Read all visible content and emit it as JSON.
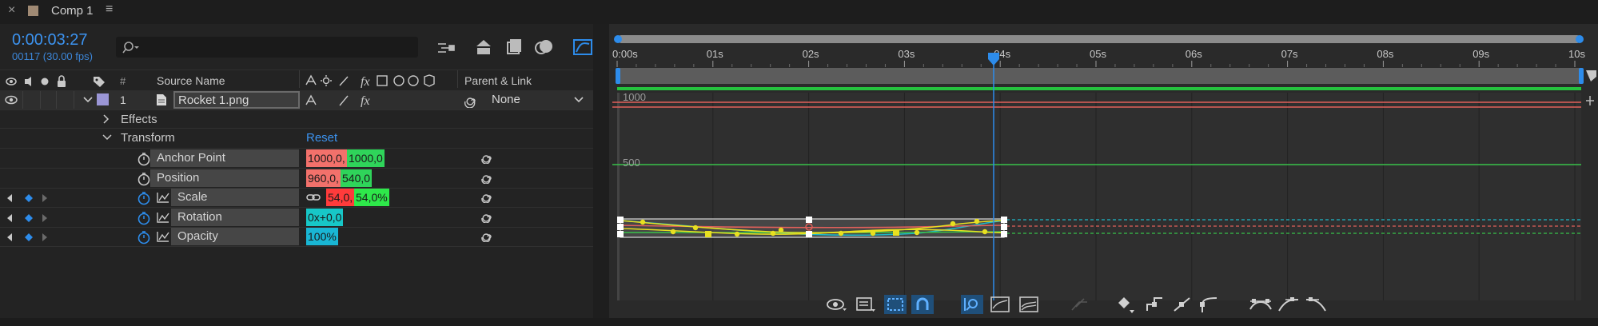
{
  "tab": {
    "close_glyph": "×",
    "title": "Comp 1",
    "menu_glyph": "≡",
    "swatch_color": "#a08a74"
  },
  "timecode": {
    "time": "0:00:03:27",
    "frames": "00117 (30.00 fps)",
    "search_placeholder": ""
  },
  "columns": {
    "number": "#",
    "source_name": "Source Name",
    "parent_link": "Parent & Link",
    "fx": "fx"
  },
  "layer": {
    "number": "1",
    "name": "Rocket 1.png",
    "parent": "None",
    "color": "#9b96d6"
  },
  "groups": {
    "effects": "Effects",
    "transform": "Transform",
    "reset": "Reset"
  },
  "properties": [
    {
      "name": "Anchor Point",
      "v1": "1000,0,",
      "v2": "1000,0",
      "c1": "#f2716b",
      "c2": "#2fd45a",
      "animated": false
    },
    {
      "name": "Position",
      "v1": "960,0,",
      "v2": "540,0",
      "c1": "#f2716b",
      "c2": "#2fd45a",
      "animated": false
    },
    {
      "name": "Scale",
      "v1": "54,0,",
      "v2": "54,0%",
      "c1": "#ff3b3b",
      "c2": "#2ee84a",
      "animated": true
    },
    {
      "name": "Rotation",
      "v1": "0x+0,0",
      "v2": "",
      "c1": "#17c7c7",
      "c2": "",
      "animated": true
    },
    {
      "name": "Opacity",
      "v1": "100%",
      "v2": "",
      "c1": "#19b6d4",
      "c2": "",
      "animated": true
    }
  ],
  "ruler": {
    "labels": [
      "0:00s",
      "01s",
      "02s",
      "03s",
      "04s",
      "05s",
      "06s",
      "07s",
      "08s",
      "09s",
      "10s"
    ]
  },
  "graph": {
    "label_top": "1000",
    "label_mid": "500",
    "colors": {
      "red": "#e2605a",
      "green": "#38c24a",
      "cyan": "#1fb8c8",
      "yellow": "#e8e020",
      "playhead": "#2d8ceb"
    }
  },
  "icons": {
    "graph_toolbar": [
      "eye-icon",
      "properties-list-icon",
      "transform-box-icon",
      "snap-magnet-icon",
      "auto-zoom-height-icon",
      "fit-selection-icon",
      "fit-all-icon",
      "separate-dimensions-icon",
      "edit-keyframe-icon",
      "hold-keyframe-icon",
      "linear-keyframe-icon",
      "auto-bezier-icon",
      "easy-ease-icon",
      "easy-ease-in-icon",
      "easy-ease-out-icon"
    ]
  }
}
